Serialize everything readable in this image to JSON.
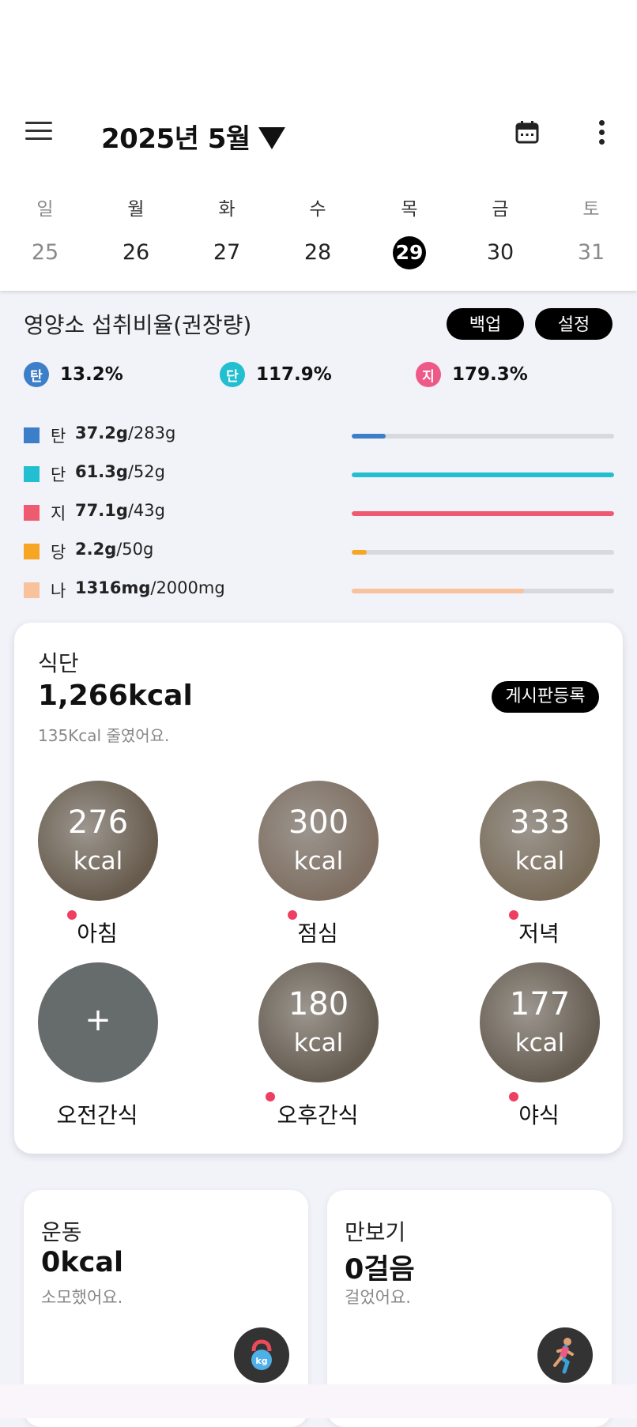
{
  "header": {
    "title": "2025년 5월",
    "menu_icon": "hamburger-menu-icon",
    "calendar_icon": "calendar-icon",
    "more_icon": "more-vertical-icon"
  },
  "week": [
    {
      "name": "일",
      "date": "25",
      "muted": true
    },
    {
      "name": "월",
      "date": "26",
      "muted": false
    },
    {
      "name": "화",
      "date": "27",
      "muted": false
    },
    {
      "name": "수",
      "date": "28",
      "muted": false
    },
    {
      "name": "목",
      "date": "29",
      "selected": true
    },
    {
      "name": "금",
      "date": "30",
      "muted": false
    },
    {
      "name": "토",
      "date": "31",
      "muted": true
    }
  ],
  "nutrition": {
    "title": "영양소 섭취비율(권장량)",
    "backup_label": "백업",
    "settings_label": "설정",
    "ratios": [
      {
        "badge": "탄",
        "value": "13.2%",
        "color": "#3d7ec9"
      },
      {
        "badge": "단",
        "value": "117.9%",
        "color": "#22bfd0"
      },
      {
        "badge": "지",
        "value": "179.3%",
        "color": "#ee5a88"
      }
    ],
    "rows": [
      {
        "label": "탄",
        "amount": "37.2g",
        "target": "/283g",
        "fill": 0.131,
        "color": "#3d7ec9"
      },
      {
        "label": "단",
        "amount": "61.3g",
        "target": "/52g",
        "fill": 1.0,
        "color": "#22bfd0"
      },
      {
        "label": "지",
        "amount": "77.1g",
        "target": "/43g",
        "fill": 1.0,
        "color": "#ee5a70"
      },
      {
        "label": "당",
        "amount": "2.2g",
        "target": "/50g",
        "fill": 0.058,
        "color": "#f6a623"
      },
      {
        "label": "나",
        "amount": "1316mg",
        "target": "/2000mg",
        "fill": 0.658,
        "color": "#f7c29c"
      }
    ]
  },
  "meals": {
    "label": "식단",
    "total": "1,266kcal",
    "sub": "135Kcal 줄였어요.",
    "board_label": "게시판등록",
    "items": [
      {
        "name": "아침",
        "kcal": "276",
        "unit": "kcal",
        "dot": true,
        "bg": "#8f7f6b"
      },
      {
        "name": "점심",
        "kcal": "300",
        "unit": "kcal",
        "dot": true,
        "bg": "#b09a88"
      },
      {
        "name": "저녁",
        "kcal": "333",
        "unit": "kcal",
        "dot": true,
        "bg": "#a8967c"
      },
      {
        "name": "오전간식",
        "plus": "+",
        "dot": false,
        "bg": "#666b6c"
      },
      {
        "name": "오후간식",
        "kcal": "180",
        "unit": "kcal",
        "dot": true,
        "bg": "#8c8070"
      },
      {
        "name": "야식",
        "kcal": "177",
        "unit": "kcal",
        "dot": true,
        "bg": "#8c8070"
      }
    ]
  },
  "exercise": {
    "title": "운동",
    "value": "0kcal",
    "sub": "소모했어요.",
    "icon": "kettlebell-icon"
  },
  "steps": {
    "title": "만보기",
    "value": "0걸음",
    "sub": "걸었어요.",
    "icon": "runner-icon"
  }
}
